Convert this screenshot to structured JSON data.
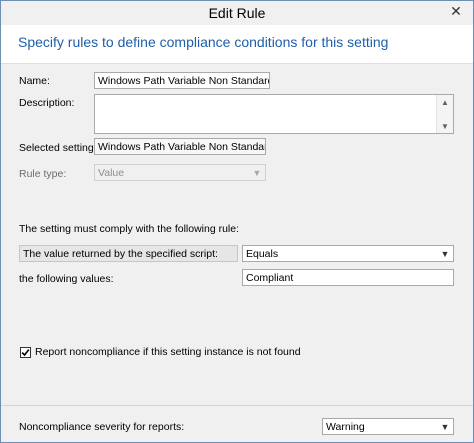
{
  "window": {
    "title": "Edit Rule",
    "close_glyph": "✕",
    "close_icon": "close-icon"
  },
  "header": {
    "text": "Specify rules to define compliance conditions for this setting"
  },
  "form": {
    "name_label": "Name:",
    "name_value": "Windows Path Variable Non Standard",
    "description_label": "Description:",
    "description_value": "",
    "selected_setting_label": "Selected setting:",
    "selected_setting_value": "Windows Path Variable Non Standard \\ Windows Path Variable Non Standard",
    "rule_type_label": "Rule type:",
    "rule_type_value": "Value"
  },
  "rule": {
    "intro": "The setting must comply with the following rule:",
    "operand_label": "The value returned by the specified script:",
    "operator_value": "Equals",
    "values_label": "the following values:",
    "values_value": "Compliant"
  },
  "report": {
    "checked": true,
    "label": "Report noncompliance if this setting instance is not found"
  },
  "footer": {
    "severity_label": "Noncompliance severity for reports:",
    "severity_value": "Warning"
  },
  "icons": {
    "dropdown": "chevron-down-icon",
    "scroll_up": "scroll-up-icon",
    "scroll_down": "scroll-down-icon"
  }
}
